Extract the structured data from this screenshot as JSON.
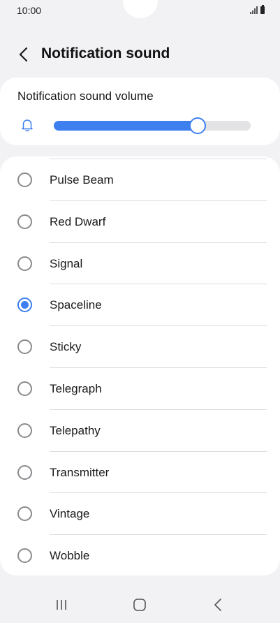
{
  "status_bar": {
    "time": "10:00"
  },
  "header": {
    "title": "Notification sound"
  },
  "volume": {
    "label": "Notification sound volume",
    "level": 0.73,
    "accent_color": "#3e7ff0"
  },
  "sounds": {
    "selected": "Spaceline",
    "items": [
      {
        "label": "Pulse Beam",
        "checked": false
      },
      {
        "label": "Red Dwarf",
        "checked": false
      },
      {
        "label": "Signal",
        "checked": false
      },
      {
        "label": "Spaceline",
        "checked": true
      },
      {
        "label": "Sticky",
        "checked": false
      },
      {
        "label": "Telegraph",
        "checked": false
      },
      {
        "label": "Telepathy",
        "checked": false
      },
      {
        "label": "Transmitter",
        "checked": false
      },
      {
        "label": "Vintage",
        "checked": false
      },
      {
        "label": "Wobble",
        "checked": false
      }
    ]
  },
  "icons": {
    "back": "chevron-left-icon",
    "bell": "bell-icon",
    "recents": "recent-apps-icon",
    "home": "home-icon",
    "nav_back": "nav-back-icon"
  }
}
